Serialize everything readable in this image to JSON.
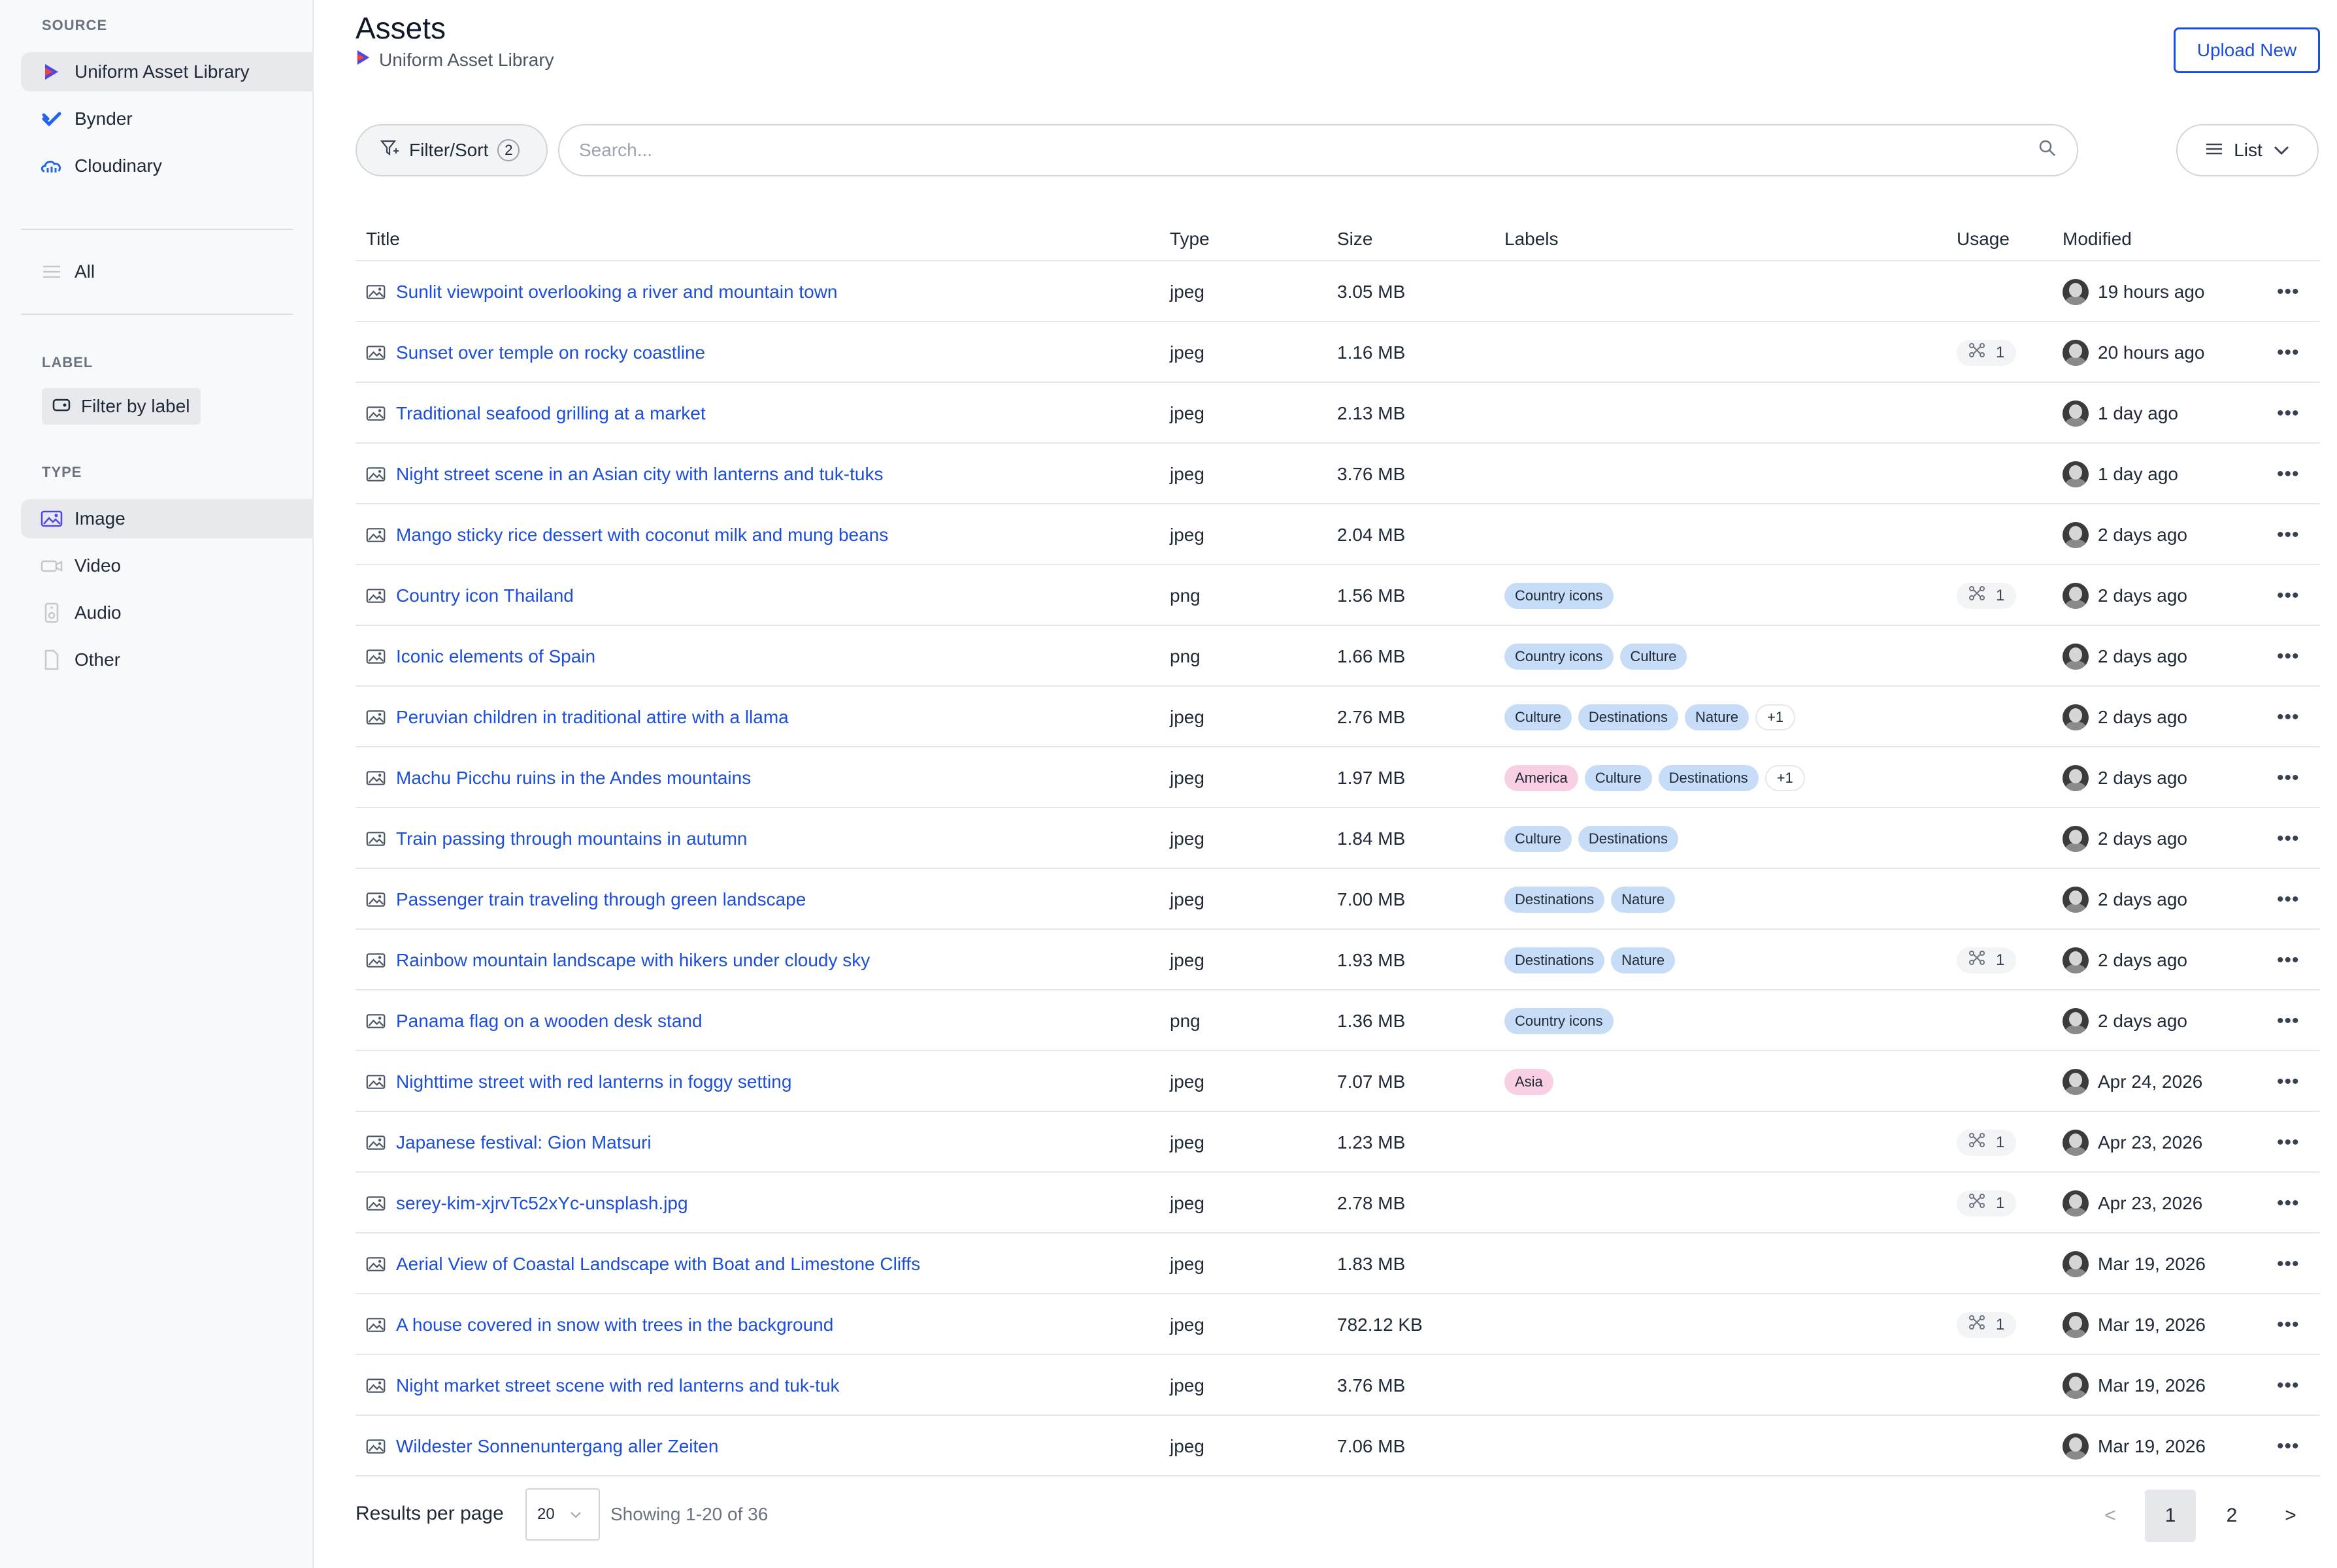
{
  "sidebar": {
    "source_heading": "SOURCE",
    "sources": [
      {
        "label": "Uniform Asset Library",
        "icon": "uniform-logo-icon",
        "active": true
      },
      {
        "label": "Bynder",
        "icon": "bynder-logo-icon",
        "active": false
      },
      {
        "label": "Cloudinary",
        "icon": "cloudinary-logo-icon",
        "active": false
      }
    ],
    "all_label": "All",
    "label_heading": "LABEL",
    "filter_by_label": "Filter by label",
    "type_heading": "TYPE",
    "types": [
      {
        "label": "Image",
        "icon": "image-icon",
        "active": true
      },
      {
        "label": "Video",
        "icon": "video-icon",
        "active": false
      },
      {
        "label": "Audio",
        "icon": "audio-icon",
        "active": false
      },
      {
        "label": "Other",
        "icon": "file-icon",
        "active": false
      }
    ]
  },
  "header": {
    "title": "Assets",
    "subtitle": "Uniform Asset Library",
    "upload_label": "Upload New"
  },
  "toolbar": {
    "filter_label": "Filter/Sort",
    "filter_count": "2",
    "search_placeholder": "Search...",
    "view_label": "List"
  },
  "table": {
    "columns": {
      "title": "Title",
      "type": "Type",
      "size": "Size",
      "labels": "Labels",
      "usage": "Usage",
      "modified": "Modified"
    },
    "rows": [
      {
        "title": "Sunlit viewpoint overlooking a river and mountain town",
        "type": "jpeg",
        "size": "3.05 MB",
        "labels": [],
        "usage": "",
        "modified": "19 hours ago"
      },
      {
        "title": "Sunset over temple on rocky coastline",
        "type": "jpeg",
        "size": "1.16 MB",
        "labels": [],
        "usage": "1",
        "modified": "20 hours ago"
      },
      {
        "title": "Traditional seafood grilling at a market",
        "type": "jpeg",
        "size": "2.13 MB",
        "labels": [],
        "usage": "",
        "modified": "1 day ago"
      },
      {
        "title": "Night street scene in an Asian city with lanterns and tuk-tuks",
        "type": "jpeg",
        "size": "3.76 MB",
        "labels": [],
        "usage": "",
        "modified": "1 day ago"
      },
      {
        "title": "Mango sticky rice dessert with coconut milk and mung beans",
        "type": "jpeg",
        "size": "2.04 MB",
        "labels": [],
        "usage": "",
        "modified": "2 days ago"
      },
      {
        "title": "Country icon Thailand",
        "type": "png",
        "size": "1.56 MB",
        "labels": [
          {
            "text": "Country icons",
            "color": "blue"
          }
        ],
        "usage": "1",
        "modified": "2 days ago"
      },
      {
        "title": "Iconic elements of Spain",
        "type": "png",
        "size": "1.66 MB",
        "labels": [
          {
            "text": "Country icons",
            "color": "blue"
          },
          {
            "text": "Culture",
            "color": "blue"
          }
        ],
        "usage": "",
        "modified": "2 days ago"
      },
      {
        "title": "Peruvian children in traditional attire with a llama",
        "type": "jpeg",
        "size": "2.76 MB",
        "labels": [
          {
            "text": "Culture",
            "color": "blue"
          },
          {
            "text": "Destinations",
            "color": "blue"
          },
          {
            "text": "Nature",
            "color": "blue"
          },
          {
            "text": "+1",
            "color": "plus"
          }
        ],
        "usage": "",
        "modified": "2 days ago"
      },
      {
        "title": "Machu Picchu ruins in the Andes mountains",
        "type": "jpeg",
        "size": "1.97 MB",
        "labels": [
          {
            "text": "America",
            "color": "pink"
          },
          {
            "text": "Culture",
            "color": "blue"
          },
          {
            "text": "Destinations",
            "color": "blue"
          },
          {
            "text": "+1",
            "color": "plus"
          }
        ],
        "usage": "",
        "modified": "2 days ago"
      },
      {
        "title": "Train passing through mountains in autumn",
        "type": "jpeg",
        "size": "1.84 MB",
        "labels": [
          {
            "text": "Culture",
            "color": "blue"
          },
          {
            "text": "Destinations",
            "color": "blue"
          }
        ],
        "usage": "",
        "modified": "2 days ago"
      },
      {
        "title": "Passenger train traveling through green landscape",
        "type": "jpeg",
        "size": "7.00 MB",
        "labels": [
          {
            "text": "Destinations",
            "color": "blue"
          },
          {
            "text": "Nature",
            "color": "blue"
          }
        ],
        "usage": "",
        "modified": "2 days ago"
      },
      {
        "title": "Rainbow mountain landscape with hikers under cloudy sky",
        "type": "jpeg",
        "size": "1.93 MB",
        "labels": [
          {
            "text": "Destinations",
            "color": "blue"
          },
          {
            "text": "Nature",
            "color": "blue"
          }
        ],
        "usage": "1",
        "modified": "2 days ago"
      },
      {
        "title": "Panama flag on a wooden desk stand",
        "type": "png",
        "size": "1.36 MB",
        "labels": [
          {
            "text": "Country icons",
            "color": "blue"
          }
        ],
        "usage": "",
        "modified": "2 days ago"
      },
      {
        "title": "Nighttime street with red lanterns in foggy setting",
        "type": "jpeg",
        "size": "7.07 MB",
        "labels": [
          {
            "text": "Asia",
            "color": "pink"
          }
        ],
        "usage": "",
        "modified": "Apr 24, 2026"
      },
      {
        "title": "Japanese festival: Gion Matsuri",
        "type": "jpeg",
        "size": "1.23 MB",
        "labels": [],
        "usage": "1",
        "modified": "Apr 23, 2026"
      },
      {
        "title": "serey-kim-xjrvTc52xYc-unsplash.jpg",
        "type": "jpeg",
        "size": "2.78 MB",
        "labels": [],
        "usage": "1",
        "modified": "Apr 23, 2026"
      },
      {
        "title": "Aerial View of Coastal Landscape with Boat and Limestone Cliffs",
        "type": "jpeg",
        "size": "1.83 MB",
        "labels": [],
        "usage": "",
        "modified": "Mar 19, 2026"
      },
      {
        "title": "A house covered in snow with trees in the background",
        "type": "jpeg",
        "size": "782.12 KB",
        "labels": [],
        "usage": "1",
        "modified": "Mar 19, 2026"
      },
      {
        "title": "Night market street scene with red lanterns and tuk-tuk",
        "type": "jpeg",
        "size": "3.76 MB",
        "labels": [],
        "usage": "",
        "modified": "Mar 19, 2026"
      },
      {
        "title": "Wildester Sonnenuntergang aller Zeiten",
        "type": "jpeg",
        "size": "7.06 MB",
        "labels": [],
        "usage": "",
        "modified": "Mar 19, 2026"
      }
    ]
  },
  "footer": {
    "results_per_page_label": "Results per page",
    "page_size": "20",
    "showing": "Showing 1-20 of 36",
    "prev": "<",
    "pages": [
      "1",
      "2"
    ],
    "current_page": "1",
    "next": ">"
  },
  "colors": {
    "accent": "#1d4ed8",
    "tag_blue": "#c7dcf7",
    "tag_pink": "#f8cfe3",
    "sidebar_bg": "#f8f9fa",
    "active_bg": "#e7e9ec"
  }
}
